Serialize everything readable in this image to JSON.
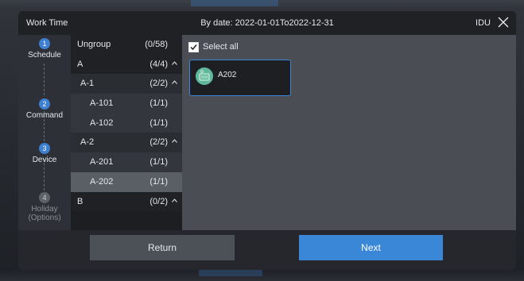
{
  "header": {
    "title": "Work Time",
    "date_range": "By date: 2022-01-01To2022-12-31",
    "mode": "IDU"
  },
  "steps": [
    {
      "number": "1",
      "label": "Schedule",
      "active": true
    },
    {
      "number": "2",
      "label": "Command",
      "active": true
    },
    {
      "number": "3",
      "label": "Device",
      "active": true
    },
    {
      "number": "4",
      "label": "Holiday (Options)",
      "active": false
    }
  ],
  "tree": [
    {
      "name": "Ungroup",
      "count": "(0/58)",
      "level": 0,
      "chevron": false,
      "selected": false
    },
    {
      "name": "A",
      "count": "(4/4)",
      "level": 0,
      "chevron": true,
      "selected": false
    },
    {
      "name": "A-1",
      "count": "(2/2)",
      "level": 1,
      "chevron": true,
      "selected": false
    },
    {
      "name": "A-101",
      "count": "(1/1)",
      "level": 2,
      "chevron": false,
      "selected": false
    },
    {
      "name": "A-102",
      "count": "(1/1)",
      "level": 2,
      "chevron": false,
      "selected": false
    },
    {
      "name": "A-2",
      "count": "(2/2)",
      "level": 1,
      "chevron": true,
      "selected": false
    },
    {
      "name": "A-201",
      "count": "(1/1)",
      "level": 2,
      "chevron": false,
      "selected": false
    },
    {
      "name": "A-202",
      "count": "(1/1)",
      "level": 2,
      "chevron": false,
      "selected": true
    },
    {
      "name": "B",
      "count": "(0/2)",
      "level": 0,
      "chevron": true,
      "selected": false
    }
  ],
  "select_all": {
    "label": "Select all",
    "checked": true
  },
  "devices": [
    {
      "name": "A202",
      "icon": "indoor-unit-icon"
    }
  ],
  "footer": {
    "return_label": "Return",
    "next_label": "Next"
  },
  "colors": {
    "accent": "#3a87d7",
    "device_icon": "#5fb89a"
  }
}
